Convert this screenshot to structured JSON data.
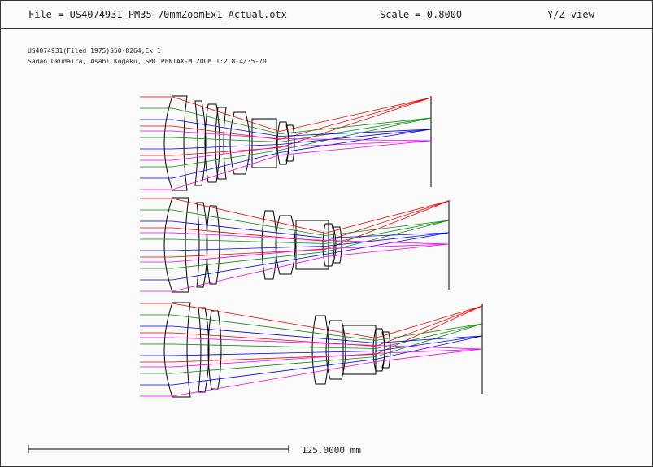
{
  "header": {
    "file": "File = US4074931_PM35-70mmZoomEx1_Actual.otx",
    "scale": "Scale = 0.8000",
    "view": "Y/Z-view"
  },
  "description": {
    "line1": "US4074931(Filed 1975)S50-8264,Ex.1",
    "line2": "Sadao Okudaira, Asahi Kogaku, SMC PENTAX-M ZOOM 1:2.8-4/35-70"
  },
  "scale_bar": {
    "label": "125.0000 mm"
  },
  "colors": {
    "lens": "#000000",
    "ray_axial": "#ee0000",
    "ray_mid": "#118811",
    "ray_field1": "#0000ee",
    "ray_field2": "#ee00ee",
    "background": "#fafafa"
  }
}
